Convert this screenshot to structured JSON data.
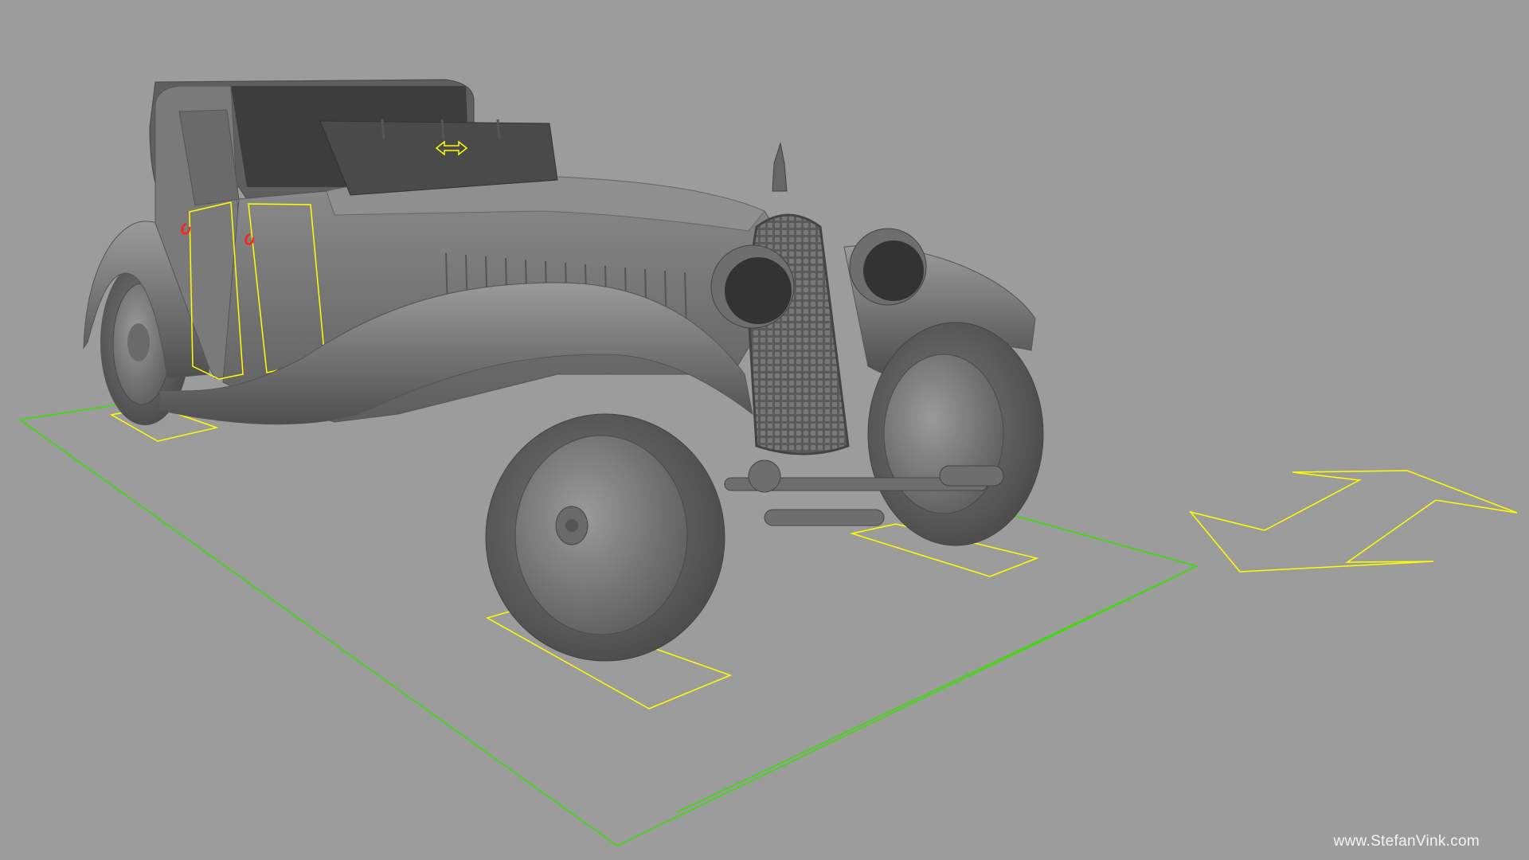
{
  "viewport": {
    "background_color": "#9c9c9c",
    "model_color": "#6f6f6f",
    "rig_guide_color": "#ffff00",
    "ground_rect_color": "#38e000",
    "control_marker_color": "#ff2020"
  },
  "scene": {
    "subject": "vintage roadster car model (untextured grey shading)",
    "icons": [
      "double-arrow-icon",
      "move-arrows-icon",
      "control-marker-icon"
    ]
  },
  "watermark": {
    "text": "www.StefanVink.com"
  }
}
